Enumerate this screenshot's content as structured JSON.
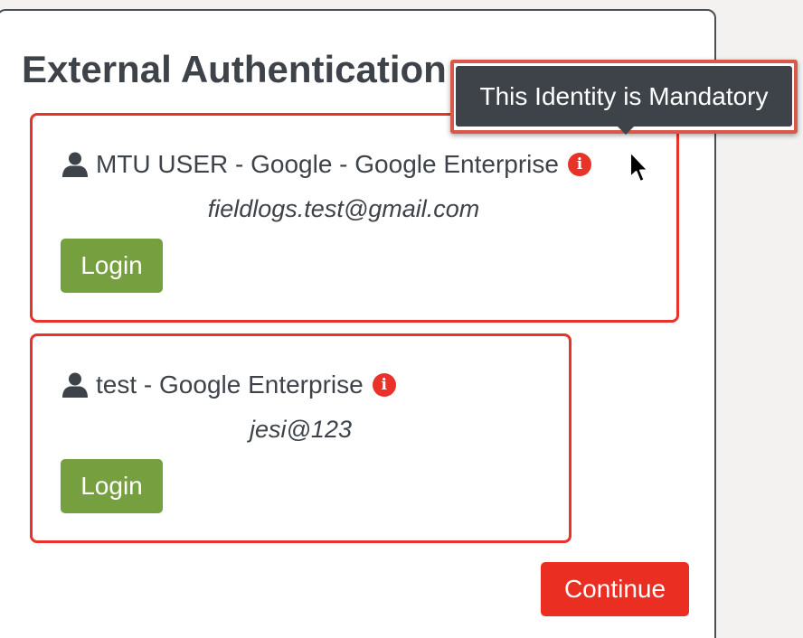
{
  "heading": "External Authentication",
  "identities": [
    {
      "name": "MTU USER - Google - Google Enterprise",
      "email": "fieldlogs.test@gmail.com",
      "login_label": "Login"
    },
    {
      "name": "test - Google Enterprise",
      "email": "jesi@123",
      "login_label": "Login"
    }
  ],
  "tooltip": "This Identity is Mandatory",
  "continue_label": "Continue",
  "icons": {
    "user": "user-icon",
    "info": "info-icon",
    "info_glyph": "i",
    "cursor": "mouse-pointer-icon"
  },
  "colors": {
    "accent_red": "#e8322a",
    "login_green": "#76a040",
    "tooltip_bg": "#3d4349",
    "text": "#3d4349"
  }
}
